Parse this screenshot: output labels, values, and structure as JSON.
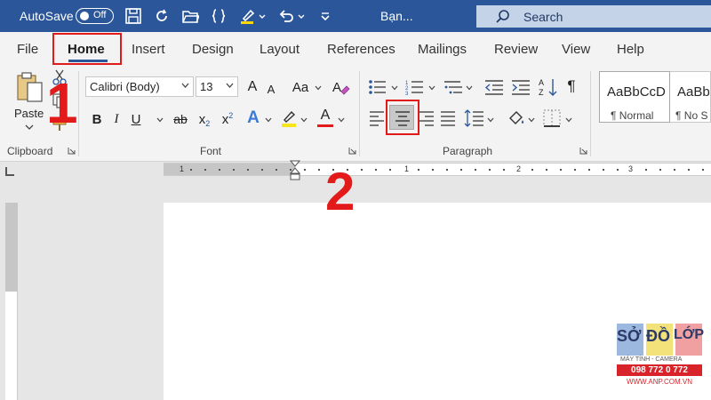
{
  "titlebar": {
    "autosave_label": "AutoSave",
    "autosave_state": "Off",
    "doc_name": "Bạn...",
    "search_placeholder": "Search",
    "background_color": "#2b579a"
  },
  "tabs": [
    {
      "label": "File",
      "active": false
    },
    {
      "label": "Home",
      "active": true
    },
    {
      "label": "Insert",
      "active": false
    },
    {
      "label": "Design",
      "active": false
    },
    {
      "label": "Layout",
      "active": false
    },
    {
      "label": "References",
      "active": false
    },
    {
      "label": "Mailings",
      "active": false
    },
    {
      "label": "Review",
      "active": false
    },
    {
      "label": "View",
      "active": false
    },
    {
      "label": "Help",
      "active": false
    }
  ],
  "ribbon": {
    "clipboard": {
      "label": "Clipboard",
      "paste_label": "Paste"
    },
    "font": {
      "label": "Font",
      "font_name": "Calibri (Body)",
      "font_size": "13",
      "change_case_label": "Aa",
      "bold_label": "B",
      "italic_label": "I",
      "underline_label": "U",
      "strikethrough_label": "ab",
      "subscript_label": "x",
      "superscript_label": "x",
      "text_effects_label": "A",
      "font_color_label": "A",
      "grow_label": "A",
      "shrink_label": "A"
    },
    "paragraph": {
      "label": "Paragraph",
      "pilcrow": "¶",
      "selected_alignment": "center"
    },
    "styles": [
      {
        "sample": "AaBbCcD",
        "name": "¶ Normal"
      },
      {
        "sample": "AaBb",
        "name": "¶ No S"
      }
    ]
  },
  "ruler": {
    "numbers": [
      "1",
      "1",
      "2",
      "3"
    ]
  },
  "annotations": {
    "step1": "1",
    "step2": "2",
    "highlight_color": "#e21a1a"
  },
  "watermark": {
    "words": [
      "SỞ",
      "ĐỒ",
      "LỚP"
    ],
    "tagline": "MÁY TÍNH - CAMERA",
    "phone": "098 772 0 772",
    "url": "WWW.ANP.COM.VN"
  }
}
